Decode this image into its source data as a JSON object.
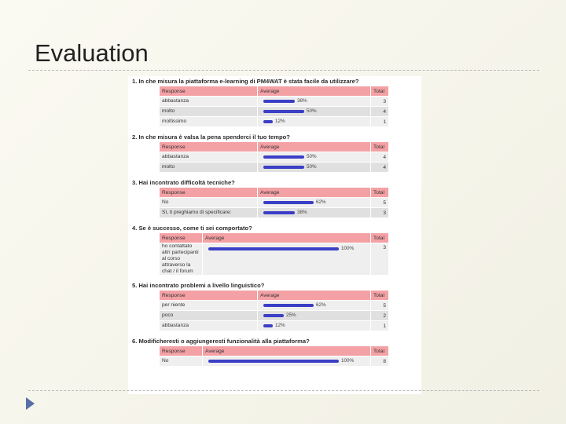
{
  "slide": {
    "title": "Evaluation"
  },
  "survey": {
    "table_headers": {
      "response": "Response",
      "average": "Average",
      "total": "Total"
    },
    "questions": [
      {
        "title": "1. In che misura la piattaforma e-learning di PM4WAT è stata facile da utilizzare?",
        "rows": [
          {
            "response": "abbastanza",
            "percent": 38,
            "percent_label": "38%",
            "total": "3"
          },
          {
            "response": "molto",
            "percent": 50,
            "percent_label": "50%",
            "total": "4"
          },
          {
            "response": "moltissimo",
            "percent": 12,
            "percent_label": "12%",
            "total": "1"
          }
        ]
      },
      {
        "title": "2. In che misura è valsa la pena spenderci il tuo tempo?",
        "rows": [
          {
            "response": "abbastanza",
            "percent": 50,
            "percent_label": "50%",
            "total": "4"
          },
          {
            "response": "molto",
            "percent": 50,
            "percent_label": "50%",
            "total": "4"
          }
        ]
      },
      {
        "title": "3. Hai incontrato difficoltà tecniche?",
        "rows": [
          {
            "response": "No",
            "percent": 62,
            "percent_label": "62%",
            "total": "5"
          },
          {
            "response": "Sì, ti preghiamo di specificare:",
            "percent": 38,
            "percent_label": "38%",
            "total": "3"
          }
        ]
      },
      {
        "title": "4. Se è successo, come ti sei comportato?",
        "narrow_response": true,
        "rows": [
          {
            "response": "ho contattato altri partecipanti al corso attraverso la chat / il forum",
            "percent": 100,
            "percent_label": "100%",
            "total": "3"
          }
        ]
      },
      {
        "title": "5. Hai incontrato problemi a livello linguistico?",
        "rows": [
          {
            "response": "per niente",
            "percent": 62,
            "percent_label": "62%",
            "total": "5"
          },
          {
            "response": "poco",
            "percent": 25,
            "percent_label": "25%",
            "total": "2"
          },
          {
            "response": "abbastanza",
            "percent": 12,
            "percent_label": "12%",
            "total": "1"
          }
        ]
      },
      {
        "title": "6. Modificheresti o aggiungeresti funzionalità alla piattaforma?",
        "narrow_response": true,
        "rows": [
          {
            "response": "No",
            "percent": 100,
            "percent_label": "100%",
            "total": "8"
          }
        ]
      }
    ]
  }
}
